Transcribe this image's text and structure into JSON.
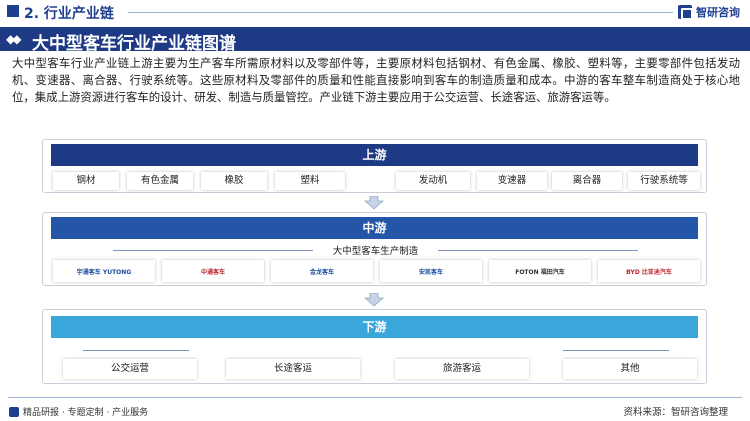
{
  "section": {
    "title": "2. 行业产业链",
    "icon": "square-icon"
  },
  "brand": {
    "name": "智研咨询",
    "icon": "brand-logo-icon"
  },
  "heading": {
    "arrows": "◆◆",
    "title": "大中型客车行业产业链图谱"
  },
  "intro": "大中型客车行业产业链上游主要为生产客车所需原材料以及零部件等，主要原材料包括钢材、有色金属、橡胶、塑料等，主要零部件包括发动机、变速器、离合器、行驶系统等。这些原材料及零部件的质量和性能直接影响到客车的制造质量和成本。中游的客车整车制造商处于核心地位，集成上游资源进行客车的设计、研发、制造与质量管控。产业链下游主要应用于公交运营、长途客运、旅游客运等。",
  "upstream": {
    "title": "上游",
    "items": [
      "钢材",
      "有色金属",
      "橡胶",
      "塑料",
      "发动机",
      "变速器",
      "离合器",
      "行驶系统等"
    ]
  },
  "midstream": {
    "title": "中游",
    "subtitle": "大中型客车生产制造",
    "logos": [
      {
        "name": "宇通客车 YUTONG",
        "color": "#1f4ea0"
      },
      {
        "name": "中通客车",
        "color": "#c0262d"
      },
      {
        "name": "金龙客车",
        "color": "#1f4ea0"
      },
      {
        "name": "安凯客车",
        "color": "#1f4ea0"
      },
      {
        "name": "FOTON 福田汽车",
        "color": "#333333"
      },
      {
        "name": "BYD 比亚迪汽车",
        "color": "#c0262d"
      }
    ]
  },
  "downstream": {
    "title": "下游",
    "items": [
      "公交运营",
      "长途客运",
      "旅游客运",
      "其他"
    ]
  },
  "footer": {
    "left": "精品研报 · 专题定制 · 产业服务",
    "source": "资料来源：智研咨询整理"
  },
  "colors": {
    "navy": "#1f3a84",
    "mid_blue": "#2456a8",
    "light_blue": "#3aa7db"
  }
}
